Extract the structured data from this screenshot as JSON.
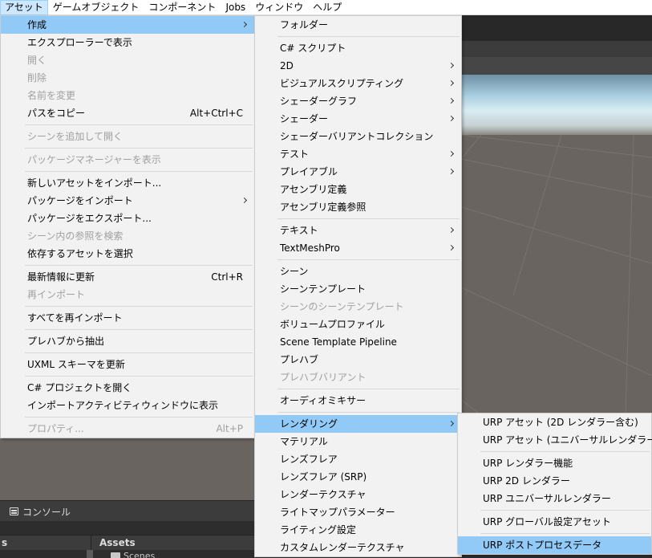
{
  "menubar": {
    "items": [
      "アセット",
      "ゲームオブジェクト",
      "コンポーネント",
      "Jobs",
      "ウィンドウ",
      "ヘルプ"
    ]
  },
  "asset_menu": {
    "items": [
      {
        "label": "作成",
        "submenu": true,
        "highlighted": true
      },
      {
        "label": "エクスプローラーで表示"
      },
      {
        "label": "開く",
        "disabled": true
      },
      {
        "label": "削除",
        "disabled": true
      },
      {
        "label": "名前を変更",
        "disabled": true
      },
      {
        "label": "パスをコピー",
        "shortcut": "Alt+Ctrl+C"
      },
      {
        "separator": true
      },
      {
        "label": "シーンを追加して開く",
        "disabled": true
      },
      {
        "separator": true
      },
      {
        "label": "パッケージマネージャーを表示",
        "disabled": true
      },
      {
        "separator": true
      },
      {
        "label": "新しいアセットをインポート..."
      },
      {
        "label": "パッケージをインポート",
        "submenu": true
      },
      {
        "label": "パッケージをエクスポート..."
      },
      {
        "label": "シーン内の参照を検索",
        "disabled": true
      },
      {
        "label": "依存するアセットを選択"
      },
      {
        "separator": true
      },
      {
        "label": "最新情報に更新",
        "shortcut": "Ctrl+R"
      },
      {
        "label": "再インポート",
        "disabled": true
      },
      {
        "separator": true
      },
      {
        "label": "すべてを再インポート"
      },
      {
        "separator": true
      },
      {
        "label": "プレハブから抽出"
      },
      {
        "separator": true
      },
      {
        "label": "UXML スキーマを更新"
      },
      {
        "separator": true
      },
      {
        "label": "C# プロジェクトを開く"
      },
      {
        "label": "インポートアクティビティウィンドウに表示"
      },
      {
        "separator": true
      },
      {
        "label": "プロパティ...",
        "shortcut": "Alt+P",
        "disabled": true
      }
    ]
  },
  "create_menu": {
    "items": [
      {
        "label": "フォルダー"
      },
      {
        "separator": true
      },
      {
        "label": "C# スクリプト"
      },
      {
        "label": "2D",
        "submenu": true
      },
      {
        "label": "ビジュアルスクリプティング",
        "submenu": true
      },
      {
        "label": "シェーダーグラフ",
        "submenu": true
      },
      {
        "label": "シェーダー",
        "submenu": true
      },
      {
        "label": "シェーダーバリアントコレクション"
      },
      {
        "label": "テスト",
        "submenu": true
      },
      {
        "label": "プレイアブル",
        "submenu": true
      },
      {
        "label": "アセンブリ定義"
      },
      {
        "label": "アセンブリ定義参照"
      },
      {
        "separator": true
      },
      {
        "label": "テキスト",
        "submenu": true
      },
      {
        "label": "TextMeshPro",
        "submenu": true
      },
      {
        "separator": true
      },
      {
        "label": "シーン"
      },
      {
        "label": "シーンテンプレート"
      },
      {
        "label": "シーンのシーンテンプレート",
        "disabled": true
      },
      {
        "label": "ボリュームプロファイル"
      },
      {
        "label": "Scene Template Pipeline"
      },
      {
        "label": "プレハブ"
      },
      {
        "label": "プレハブバリアント",
        "disabled": true
      },
      {
        "separator": true
      },
      {
        "label": "オーディオミキサー"
      },
      {
        "separator": true
      },
      {
        "label": "レンダリング",
        "submenu": true,
        "highlighted": true
      },
      {
        "label": "マテリアル"
      },
      {
        "label": "レンズフレア"
      },
      {
        "label": "レンズフレア (SRP)"
      },
      {
        "label": "レンダーテクスチャ"
      },
      {
        "label": "ライトマップパラメーター"
      },
      {
        "label": "ライティング設定"
      },
      {
        "label": "カスタムレンダーテクスチャ"
      }
    ]
  },
  "rendering_menu": {
    "items": [
      {
        "label": "URP アセット (2D レンダラー含む)"
      },
      {
        "label": "URP アセット (ユニバーサルレンダラー含む)"
      },
      {
        "separator": true
      },
      {
        "label": "URP レンダラー機能"
      },
      {
        "label": "URP 2D レンダラー"
      },
      {
        "label": "URP ユニバーサルレンダラー"
      },
      {
        "separator": true
      },
      {
        "label": "URP グローバル設定アセット"
      },
      {
        "separator": true
      },
      {
        "label": "URP ポストプロセスデータ",
        "highlighted": true
      }
    ]
  },
  "console": {
    "tab_label": "コンソール",
    "icon": "console-icon"
  },
  "project": {
    "left_header": "s",
    "assets_header": "Assets",
    "folder_label": "Scenes",
    "folder_icon": "folder-icon"
  },
  "colors": {
    "highlight": "#91c9f7",
    "menu_bg": "#f2f2f2",
    "menubar_active": "#cce8ff"
  }
}
